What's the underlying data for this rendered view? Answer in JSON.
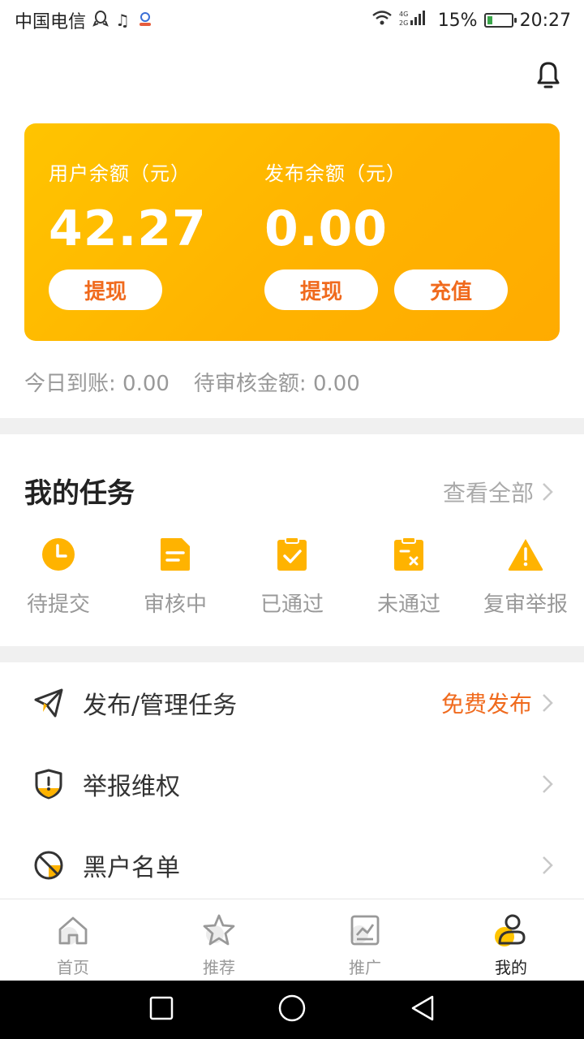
{
  "status_bar": {
    "carrier": "中国电信",
    "network": "4G 2G",
    "battery_percent": "15%",
    "time": "20:27"
  },
  "balance": {
    "user_label": "用户余额（元）",
    "user_value": "42.27",
    "publish_label": "发布余额（元）",
    "publish_value": "0.00",
    "withdraw_user": "提现",
    "withdraw_publish": "提现",
    "recharge": "充值",
    "today_arrival": "今日到账: 0.00",
    "pending_review": "待审核金额: 0.00"
  },
  "tasks": {
    "title": "我的任务",
    "view_all": "查看全部",
    "items": [
      {
        "label": "待提交",
        "icon": "clock-icon"
      },
      {
        "label": "审核中",
        "icon": "document-icon"
      },
      {
        "label": "已通过",
        "icon": "clipboard-check-icon"
      },
      {
        "label": "未通过",
        "icon": "clipboard-x-icon"
      },
      {
        "label": "复审举报",
        "icon": "warning-icon"
      }
    ]
  },
  "menu": {
    "items": [
      {
        "label": "发布/管理任务",
        "extra": "免费发布",
        "icon": "paper-plane-icon"
      },
      {
        "label": "举报维权",
        "extra": "",
        "icon": "shield-warning-icon"
      },
      {
        "label": "黑户名单",
        "extra": "",
        "icon": "ban-icon"
      }
    ]
  },
  "tabbar": {
    "items": [
      {
        "label": "首页",
        "icon": "home-icon"
      },
      {
        "label": "推荐",
        "icon": "star-icon"
      },
      {
        "label": "推广",
        "icon": "chart-icon"
      },
      {
        "label": "我的",
        "icon": "user-icon"
      }
    ]
  },
  "colors": {
    "accent": "#ffb300",
    "orange_text": "#f06a1d",
    "muted": "#999999"
  }
}
